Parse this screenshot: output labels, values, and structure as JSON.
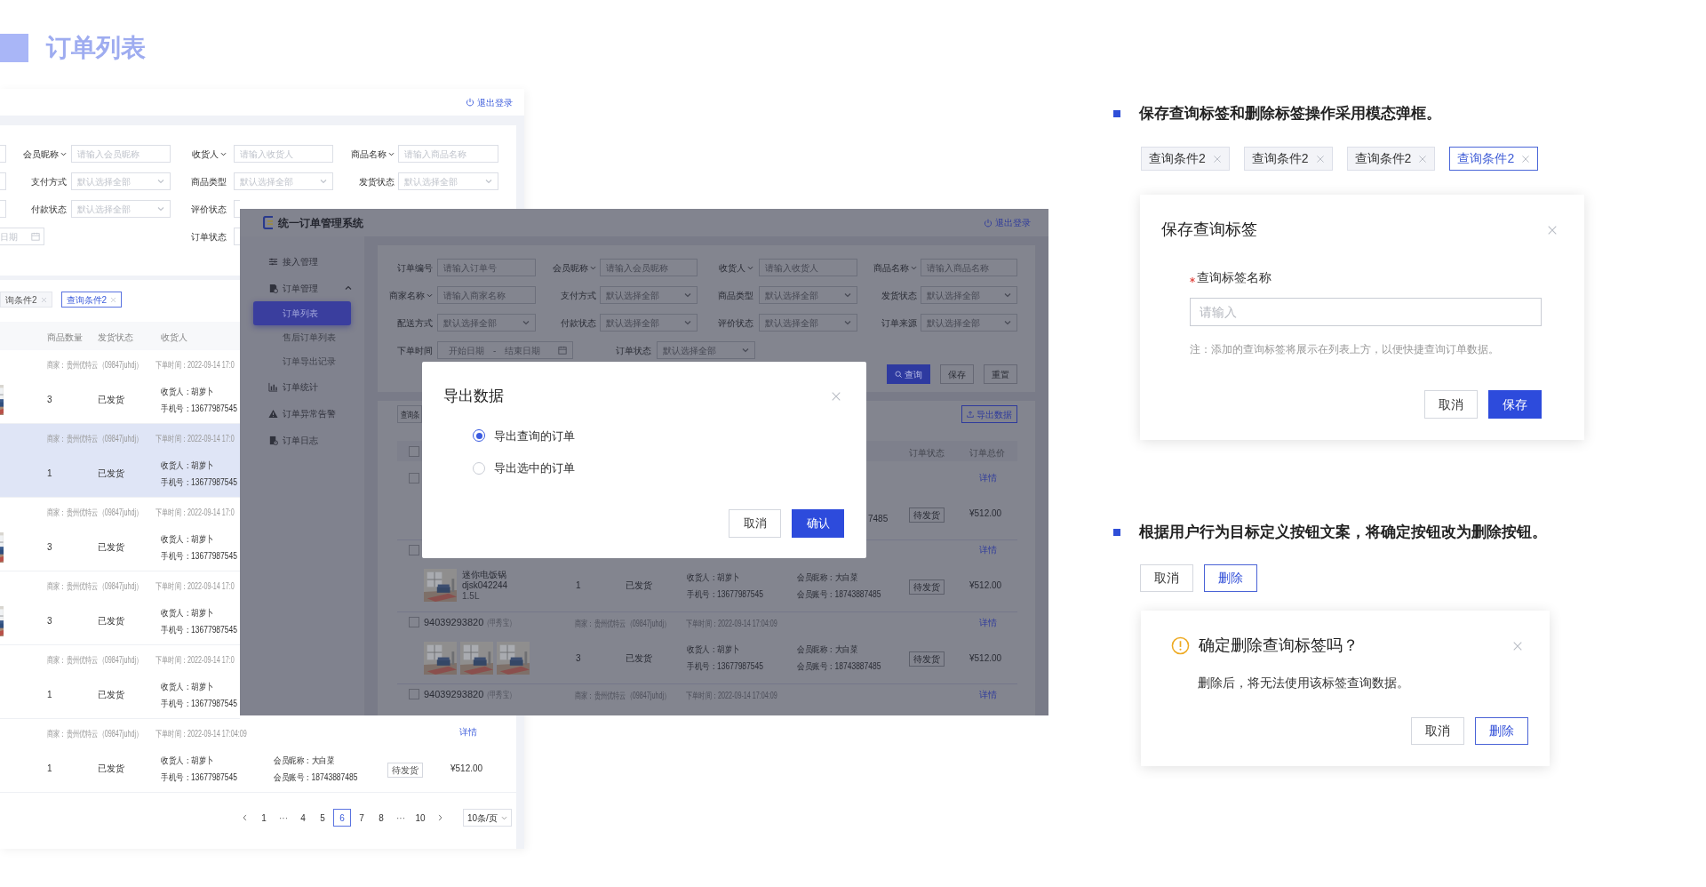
{
  "page_title": "订单列表",
  "back_screen": {
    "logout": "退出登录",
    "filter_rows": [
      [
        {
          "kind": "stub"
        },
        {
          "kind": "input",
          "label": "会员昵称",
          "dropdown": true,
          "placeholder": "请输入会员昵称"
        },
        {
          "kind": "input",
          "label": "收货人",
          "dropdown": true,
          "placeholder": "请输入收货人"
        },
        {
          "kind": "input",
          "label": "商品名称",
          "dropdown": true,
          "placeholder": "请输入商品名称"
        }
      ],
      [
        {
          "kind": "stub"
        },
        {
          "kind": "select",
          "label": "支付方式",
          "dropdown": false,
          "placeholder": "默认选择全部"
        },
        {
          "kind": "select",
          "label": "商品类型",
          "dropdown": false,
          "placeholder": "默认选择全部"
        },
        {
          "kind": "select",
          "label": "发货状态",
          "dropdown": false,
          "placeholder": "默认选择全部"
        }
      ],
      [
        {
          "kind": "stub"
        },
        {
          "kind": "select",
          "label": "付款状态",
          "dropdown": false,
          "placeholder": "默认选择全部"
        },
        {
          "kind": "label_only",
          "label": "评价状态",
          "dropdown": false
        }
      ],
      [
        {
          "kind": "date_stub",
          "text": "日期"
        },
        {
          "kind": "blank"
        },
        {
          "kind": "label_only",
          "label": "订单状态",
          "dropdown": false
        }
      ]
    ],
    "tags": [
      {
        "label": "询条件2",
        "selected": false
      },
      {
        "label": "查询条件2",
        "selected": true
      }
    ],
    "columns": [
      "商品数量",
      "发货状态",
      "收货人"
    ],
    "rows": [
      {
        "shop": "商家：贵州优特云（09847juhdj）",
        "time": "下单时间：2022-09-14 17:0",
        "hovered": false,
        "quantity": "3",
        "shipping": "已发货",
        "receiver": "收货人：胡萝卜",
        "phone": "手机号：13677987545"
      },
      {
        "shop": "商家：贵州优特云（09847juhdj）",
        "time": "下单时间：2022-09-14 17:0",
        "hovered": true,
        "quantity": "1",
        "shipping": "已发货",
        "receiver": "收货人：胡萝卜",
        "phone": "手机号：13677987545"
      },
      {
        "shop": "商家：贵州优特云（09847juhdj）",
        "time": "下单时间：2022-09-14 17:0",
        "hovered": false,
        "quantity": "3",
        "shipping": "已发货",
        "receiver": "收货人：胡萝卜",
        "phone": "手机号：13677987545"
      },
      {
        "shop": "商家：贵州优特云（09847juhdj）",
        "time": "下单时间：2022-09-14 17:0",
        "hovered": false,
        "quantity": "3",
        "shipping": "已发货",
        "receiver": "收货人：胡萝卜",
        "phone": "手机号：13677987545"
      },
      {
        "shop": "商家：贵州优特云（09847juhdj）",
        "time": "下单时间：2022-09-14 17:0",
        "hovered": false,
        "quantity": "1",
        "shipping": "已发货",
        "receiver": "收货人：胡萝卜",
        "phone": "手机号：13677987545"
      },
      {
        "shop": "商家：贵州优特云（09847juhdj）",
        "time": "下单时间：2022-09-14 17:04:09",
        "detail": "详情",
        "hovered": false,
        "quantity": "1",
        "shipping": "已发货",
        "receiver": "收货人：胡萝卜",
        "phone": "手机号：13677987545",
        "member_name": "会员昵称：大白菜",
        "member_account": "会员账号：18743887485",
        "status": "待发货",
        "price": "¥512.00"
      }
    ],
    "pagination": [
      {
        "kind": "prev"
      },
      {
        "kind": "page",
        "text": "1",
        "selected": false
      },
      {
        "kind": "ellipsis",
        "text": "···"
      },
      {
        "kind": "page",
        "text": "4",
        "selected": false
      },
      {
        "kind": "page",
        "text": "5",
        "selected": false
      },
      {
        "kind": "page",
        "text": "6",
        "selected": true
      },
      {
        "kind": "page",
        "text": "7",
        "selected": false
      },
      {
        "kind": "page",
        "text": "8",
        "selected": false
      },
      {
        "kind": "ellipsis",
        "text": "···"
      },
      {
        "kind": "page",
        "text": "10",
        "selected": false
      },
      {
        "kind": "next"
      }
    ],
    "page_size": "10条/页"
  },
  "middle_screen": {
    "app_title": "统一订单管理系统",
    "logout": "退出登录",
    "sidebar": [
      {
        "label": "接入管理"
      },
      {
        "label": "订单管理",
        "expanded": true,
        "children": [
          {
            "label": "订单列表",
            "selected": true
          },
          {
            "label": "售后订单列表",
            "selected": false
          },
          {
            "label": "订单导出记录",
            "selected": false
          }
        ]
      },
      {
        "label": "订单统计"
      },
      {
        "label": "订单异常告警"
      },
      {
        "label": "订单日志"
      }
    ],
    "filter_rows": [
      [
        {
          "kind": "input",
          "label": "订单编号",
          "dropdown": false,
          "placeholder": "请输入订单号"
        },
        {
          "kind": "input",
          "label": "会员昵称",
          "dropdown": true,
          "placeholder": "请输入会员昵称"
        },
        {
          "kind": "input",
          "label": "收货人",
          "dropdown": true,
          "placeholder": "请输入收货人"
        },
        {
          "kind": "input",
          "label": "商品名称",
          "dropdown": true,
          "placeholder": "请输入商品名称"
        }
      ],
      [
        {
          "kind": "input",
          "label": "商家名称",
          "dropdown": true,
          "placeholder": "请输入商家名称"
        },
        {
          "kind": "select",
          "label": "支付方式",
          "dropdown": false,
          "placeholder": "默认选择全部"
        },
        {
          "kind": "select",
          "label": "商品类型",
          "dropdown": false,
          "placeholder": "默认选择全部"
        },
        {
          "kind": "select",
          "label": "发货状态",
          "dropdown": false,
          "placeholder": "默认选择全部"
        }
      ],
      [
        {
          "kind": "select",
          "label": "配送方式",
          "dropdown": false,
          "placeholder": "默认选择全部"
        },
        {
          "kind": "select",
          "label": "付款状态",
          "dropdown": false,
          "placeholder": "默认选择全部"
        },
        {
          "kind": "select",
          "label": "评价状态",
          "dropdown": false,
          "placeholder": "默认选择全部"
        },
        {
          "kind": "select",
          "label": "订单来源",
          "dropdown": false,
          "placeholder": "默认选择全部"
        }
      ],
      [
        {
          "kind": "date_range",
          "label": "下单时间",
          "dropdown": false,
          "start": "开始日期",
          "separator": "-",
          "end": "结束日期"
        },
        {
          "kind": "blank"
        },
        {
          "kind": "select",
          "label": "订单状态",
          "dropdown": false,
          "placeholder": "默认选择全部"
        }
      ]
    ],
    "buttons": [
      "查询",
      "保存",
      "重置"
    ],
    "list": {
      "tag": "查询条",
      "export_button": "导出数据",
      "select_all_checked": false,
      "columns": [
        "订单状态",
        "订单总价"
      ],
      "rows": [
        {
          "checked": false,
          "detail": "详情",
          "fragment": "7485",
          "status": "待发货",
          "price": "¥512.00"
        },
        {
          "checked": false,
          "detail": "详情",
          "product_name": "迷你电饭锅",
          "product_code": "djsk042244",
          "product_spec": "1.5L",
          "quantity": "1",
          "shipping": "已发货",
          "receiver": "收货人：胡萝卜",
          "phone": "手机号：13677987545",
          "member_name": "会员昵称：大白菜",
          "member_account": "会员账号：18743887485",
          "status": "待发货",
          "price": "¥512.00"
        },
        {
          "checked": false,
          "order_no": "94039293820",
          "store": "（甲秀宝）",
          "shop": "商家：贵州优特云（09847juhdj）",
          "time": "下单时间：2022-09-14 17:04:09",
          "detail": "详情",
          "quantity": "3",
          "shipping": "已发货",
          "receiver": "收货人：胡萝卜",
          "phone": "手机号：13677987545",
          "member_name": "会员昵称：大白菜",
          "member_account": "会员账号：18743887485",
          "status": "待发货",
          "price": "¥512.00"
        },
        {
          "checked": false,
          "order_no": "94039293820",
          "store": "（甲秀宝）",
          "shop": "商家：贵州优特云（09847juhdj）",
          "time": "下单时间：2022-09-14 17:04:09",
          "detail": "详情"
        }
      ]
    },
    "modal": {
      "title": "导出数据",
      "options": [
        {
          "label": "导出查询的订单",
          "selected": true
        },
        {
          "label": "导出选中的订单",
          "selected": false
        }
      ],
      "buttons": [
        "取消",
        "确认"
      ]
    }
  },
  "save_section": {
    "heading": "保存查询标签和删除标签操作采用模态弹框。",
    "tags": [
      {
        "label": "查询条件2",
        "selected": false
      },
      {
        "label": "查询条件2",
        "selected": false
      },
      {
        "label": "查询条件2",
        "selected": false
      },
      {
        "label": "查询条件2",
        "selected": true
      }
    ],
    "dialog": {
      "title": "保存查询标签",
      "required": true,
      "field_label": "查询标签名称",
      "placeholder": "请输入",
      "note": "注：添加的查询标签将展示在列表上方，以便快捷查询订单数据。",
      "buttons": [
        "取消",
        "保存"
      ]
    }
  },
  "delete_section": {
    "heading": "根据用户行为目标定义按钮文案，将确定按钮改为删除按钮。",
    "buttons": [
      "取消",
      "删除"
    ],
    "dialog": {
      "title": "确定删除查询标签吗？",
      "message": "删除后，将无法使用该标签查询数据。",
      "buttons": [
        "取消",
        "删除"
      ]
    }
  }
}
